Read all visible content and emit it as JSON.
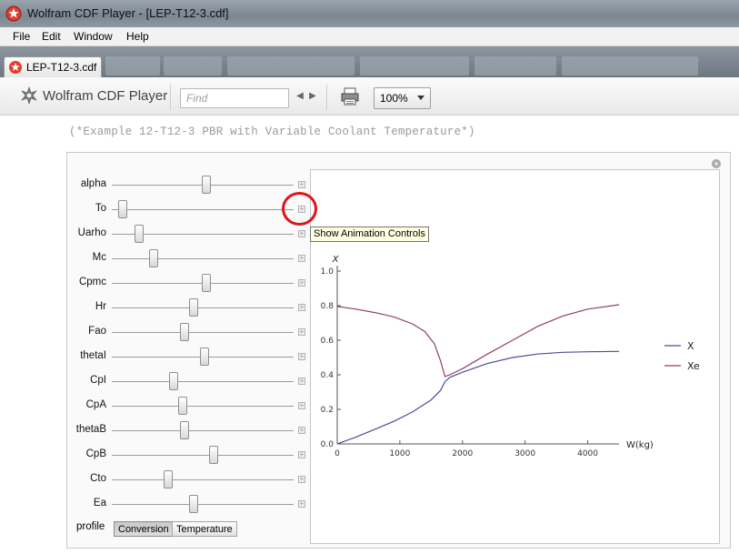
{
  "window": {
    "title": "Wolfram CDF Player - [LEP-T12-3.cdf]"
  },
  "menu": [
    "File",
    "Edit",
    "Window",
    "Help"
  ],
  "tab": {
    "label": "LEP-T12-3.cdf"
  },
  "toolbar": {
    "brand": "Wolfram CDF Player",
    "find_placeholder": "Find",
    "zoom": "100%"
  },
  "comment": "(*Example 12-T12-3 PBR with Variable Coolant Temperature*)",
  "controls": [
    {
      "label": "alpha",
      "value": 0.52
    },
    {
      "label": "To",
      "value": 0.06
    },
    {
      "label": "Uarho",
      "value": 0.15
    },
    {
      "label": "Mc",
      "value": 0.23
    },
    {
      "label": "Cpmc",
      "value": 0.52
    },
    {
      "label": "Hr",
      "value": 0.45
    },
    {
      "label": "Fao",
      "value": 0.4
    },
    {
      "label": "thetaI",
      "value": 0.51
    },
    {
      "label": "CpI",
      "value": 0.34
    },
    {
      "label": "CpA",
      "value": 0.39
    },
    {
      "label": "thetaB",
      "value": 0.4
    },
    {
      "label": "CpB",
      "value": 0.56
    },
    {
      "label": "Cto",
      "value": 0.31
    },
    {
      "label": "Ea",
      "value": 0.45
    }
  ],
  "profile": {
    "label": "profile",
    "options": [
      "Conversion",
      "Temperature"
    ],
    "selected": "Conversion"
  },
  "tooltip": "Show Animation Controls",
  "colors": {
    "X": "#4a4f9a",
    "Xe": "#8e3f66",
    "highlight": "#e0141a"
  },
  "chart_data": {
    "type": "line",
    "xlabel": "W(kg)",
    "ylabel": "X",
    "xlim": [
      0,
      4500
    ],
    "ylim": [
      0,
      1.0
    ],
    "xticks": [
      "0",
      "1000",
      "2000",
      "3000",
      "4000"
    ],
    "yticks": [
      "0.0",
      "0.2",
      "0.4",
      "0.6",
      "0.8",
      "1.0"
    ],
    "legend": "right",
    "series": [
      {
        "name": "X",
        "x": [
          0,
          300,
          600,
          900,
          1200,
          1500,
          1650,
          1720,
          1800,
          2000,
          2400,
          2800,
          3200,
          3600,
          4000,
          4500
        ],
        "y": [
          0.0,
          0.04,
          0.085,
          0.13,
          0.185,
          0.255,
          0.31,
          0.36,
          0.385,
          0.415,
          0.465,
          0.5,
          0.52,
          0.53,
          0.533,
          0.535
        ]
      },
      {
        "name": "Xe",
        "x": [
          0,
          300,
          600,
          900,
          1200,
          1400,
          1550,
          1650,
          1720,
          1800,
          2000,
          2400,
          2800,
          3200,
          3600,
          4000,
          4500
        ],
        "y": [
          0.795,
          0.78,
          0.76,
          0.735,
          0.695,
          0.65,
          0.58,
          0.48,
          0.39,
          0.4,
          0.435,
          0.52,
          0.6,
          0.68,
          0.74,
          0.78,
          0.805
        ]
      }
    ]
  }
}
